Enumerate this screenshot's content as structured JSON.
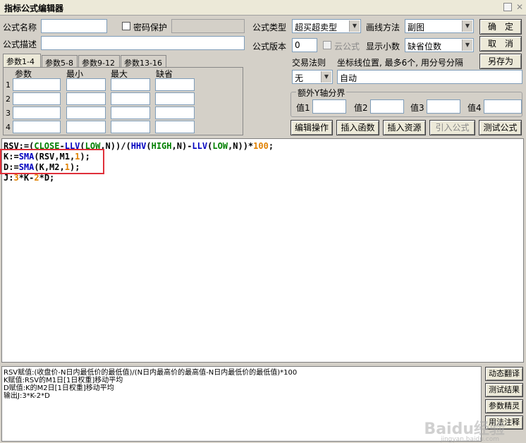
{
  "window": {
    "title": "指标公式编辑器"
  },
  "form": {
    "name_label": "公式名称",
    "name_value": "",
    "password_label": "密码保护",
    "desc_label": "公式描述",
    "desc_value": "",
    "type_label": "公式类型",
    "type_value": "超买超卖型",
    "draw_label": "画线方法",
    "draw_value": "副图",
    "version_label": "公式版本",
    "version_value": "0",
    "cloud_label": "云公式",
    "decimal_label": "显示小数",
    "decimal_value": "缺省位数",
    "trade_label": "交易法则",
    "trade_value": "无",
    "coord_label": "坐标线位置, 最多6个, 用分号分隔",
    "coord_value": "自动",
    "yaxis_label": "额外Y轴分界",
    "val1": "值1",
    "val2": "值2",
    "val3": "值3",
    "val4": "值4"
  },
  "buttons": {
    "ok": "确　定",
    "cancel": "取　消",
    "save_as": "另存为",
    "edit_ops": "编辑操作",
    "insert_func": "插入函数",
    "insert_res": "插入资源",
    "import_formula": "引入公式",
    "test_formula": "测试公式"
  },
  "tabs": [
    "参数1-4",
    "参数5-8",
    "参数9-12",
    "参数13-16"
  ],
  "params": {
    "headers": [
      "参数",
      "最小",
      "最大",
      "缺省"
    ],
    "rows": [
      "1",
      "2",
      "3",
      "4"
    ]
  },
  "code": {
    "l1": [
      {
        "t": "RSV:=(",
        "c": "#000000"
      },
      {
        "t": "CLOSE",
        "c": "#008000"
      },
      {
        "t": "-",
        "c": "#000000"
      },
      {
        "t": "LLV",
        "c": "#0000c0"
      },
      {
        "t": "(",
        "c": "#000000"
      },
      {
        "t": "LOW",
        "c": "#008000"
      },
      {
        "t": ",N))/(",
        "c": "#000000"
      },
      {
        "t": "HHV",
        "c": "#0000c0"
      },
      {
        "t": "(",
        "c": "#000000"
      },
      {
        "t": "HIGH",
        "c": "#008000"
      },
      {
        "t": ",N)-",
        "c": "#000000"
      },
      {
        "t": "LLV",
        "c": "#0000c0"
      },
      {
        "t": "(",
        "c": "#000000"
      },
      {
        "t": "LOW",
        "c": "#008000"
      },
      {
        "t": ",N))*",
        "c": "#000000"
      },
      {
        "t": "100",
        "c": "#e08000"
      },
      {
        "t": ";",
        "c": "#000000"
      }
    ],
    "l2": [
      {
        "t": "K:=",
        "c": "#000000"
      },
      {
        "t": "SMA",
        "c": "#0000c0"
      },
      {
        "t": "(RSV,M1,",
        "c": "#000000"
      },
      {
        "t": "1",
        "c": "#e08000"
      },
      {
        "t": ");",
        "c": "#000000"
      }
    ],
    "l3": [
      {
        "t": "D:=",
        "c": "#000000"
      },
      {
        "t": "SMA",
        "c": "#0000c0"
      },
      {
        "t": "(K,M2,",
        "c": "#000000"
      },
      {
        "t": "1",
        "c": "#e08000"
      },
      {
        "t": ");",
        "c": "#000000"
      }
    ],
    "l4": [
      {
        "t": "J:",
        "c": "#000000"
      },
      {
        "t": "3",
        "c": "#e08000"
      },
      {
        "t": "*K-",
        "c": "#000000"
      },
      {
        "t": "2",
        "c": "#e08000"
      },
      {
        "t": "*D;",
        "c": "#000000"
      }
    ]
  },
  "output": [
    "RSV赋值:(收盘价-N日内最低价的最低值)/(N日内最高价的最高值-N日内最低价的最低值)*100",
    "K赋值:RSV的M1日[1日权重]移动平均",
    "D赋值:K的M2日[1日权重]移动平均",
    "输出J:3*K-2*D"
  ],
  "side_buttons": [
    "动态翻译",
    "测试结果",
    "参数精灵",
    "用法注释"
  ],
  "watermark": {
    "brand": "Baidu经验",
    "url": "jingyan.baidu.com"
  }
}
